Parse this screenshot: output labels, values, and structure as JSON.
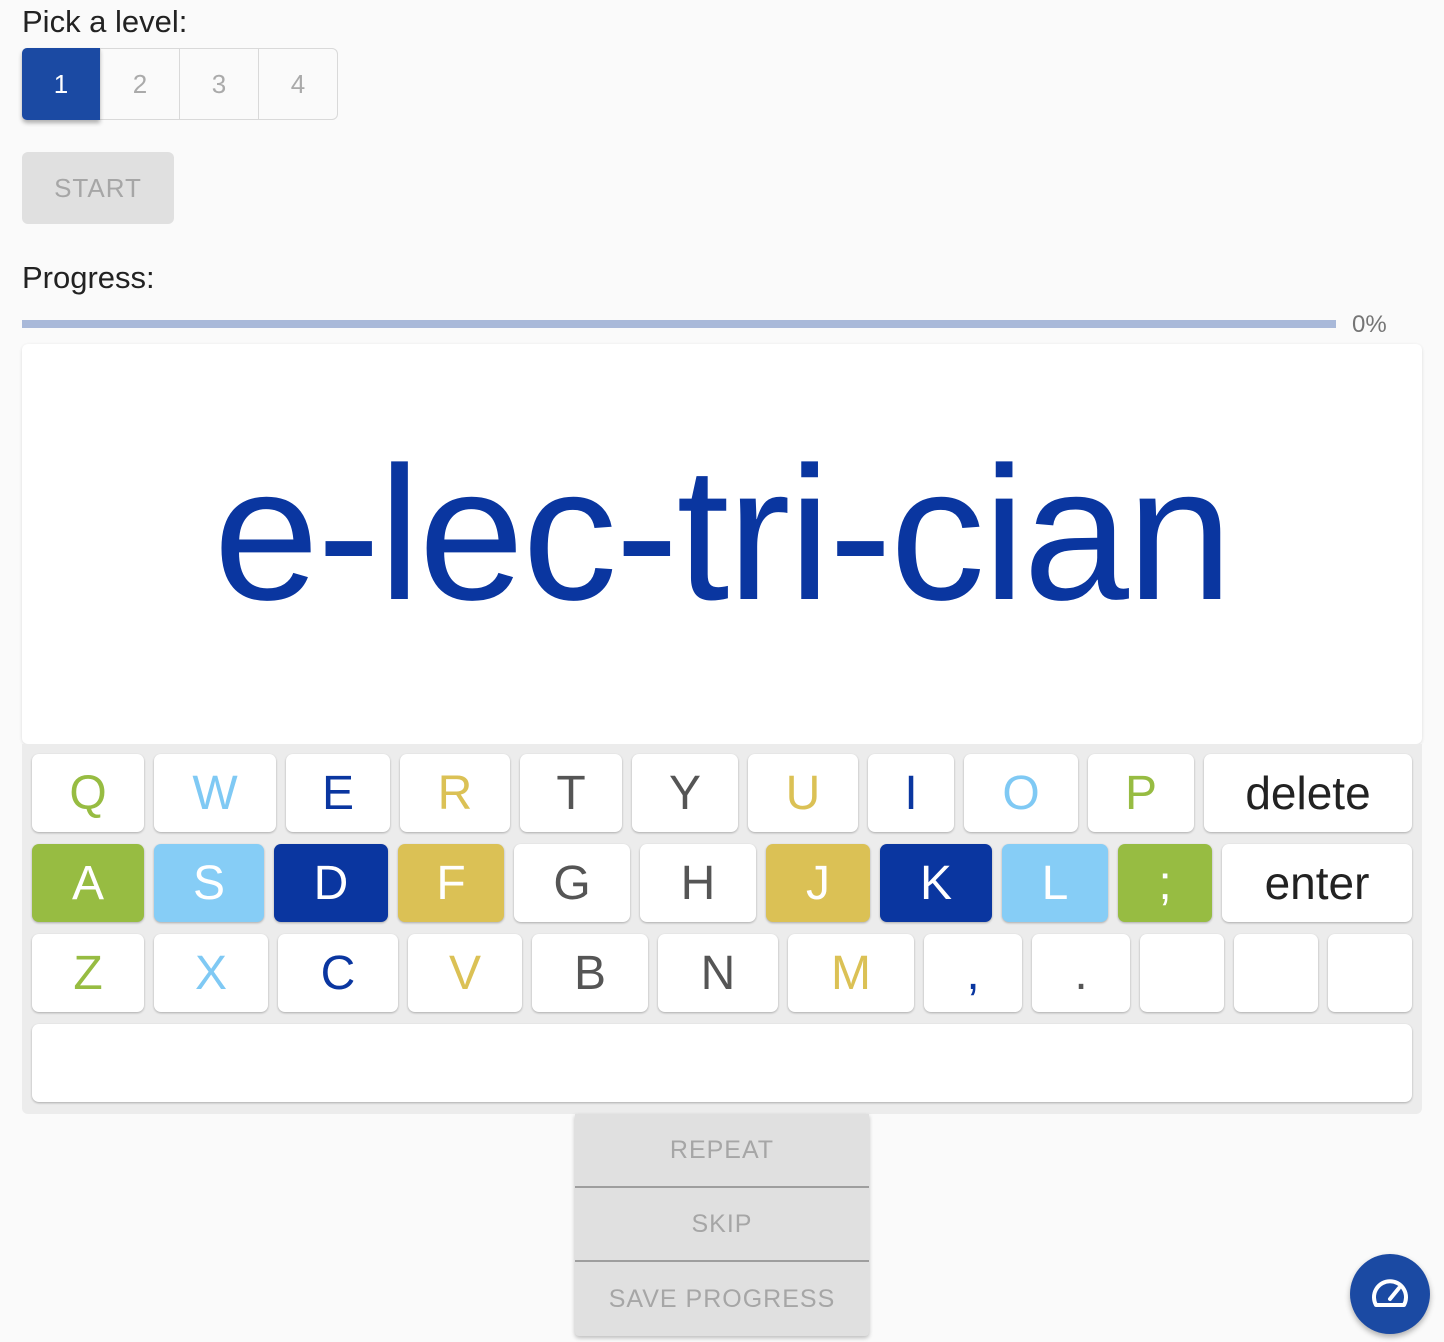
{
  "level_picker": {
    "label": "Pick a level:",
    "levels": [
      "1",
      "2",
      "3",
      "4"
    ],
    "selected": "1"
  },
  "start_label": "START",
  "progress": {
    "label": "Progress:",
    "value_text": "0%",
    "value": 0
  },
  "word": "e-lec-tri-cian",
  "keyboard": {
    "row1": [
      "Q",
      "W",
      "E",
      "R",
      "T",
      "Y",
      "U",
      "I",
      "O",
      "P",
      "delete"
    ],
    "row2": [
      "A",
      "S",
      "D",
      "F",
      "G",
      "H",
      "J",
      "K",
      "L",
      ";",
      "enter"
    ],
    "row3": [
      "Z",
      "X",
      "C",
      "V",
      "B",
      "N",
      "M",
      ",",
      ".",
      "",
      "",
      ""
    ],
    "space": ""
  },
  "actions": {
    "repeat": "REPEAT",
    "skip": "SKIP",
    "save": "SAVE PROGRESS"
  },
  "fab_icon": "speedometer-icon",
  "colors": {
    "accent": "#1b4aa3",
    "word": "#0a36a0",
    "green": "#97bc42",
    "light_blue": "#86cdf6",
    "dark_blue": "#0a36a0",
    "yellow": "#dbc155"
  }
}
